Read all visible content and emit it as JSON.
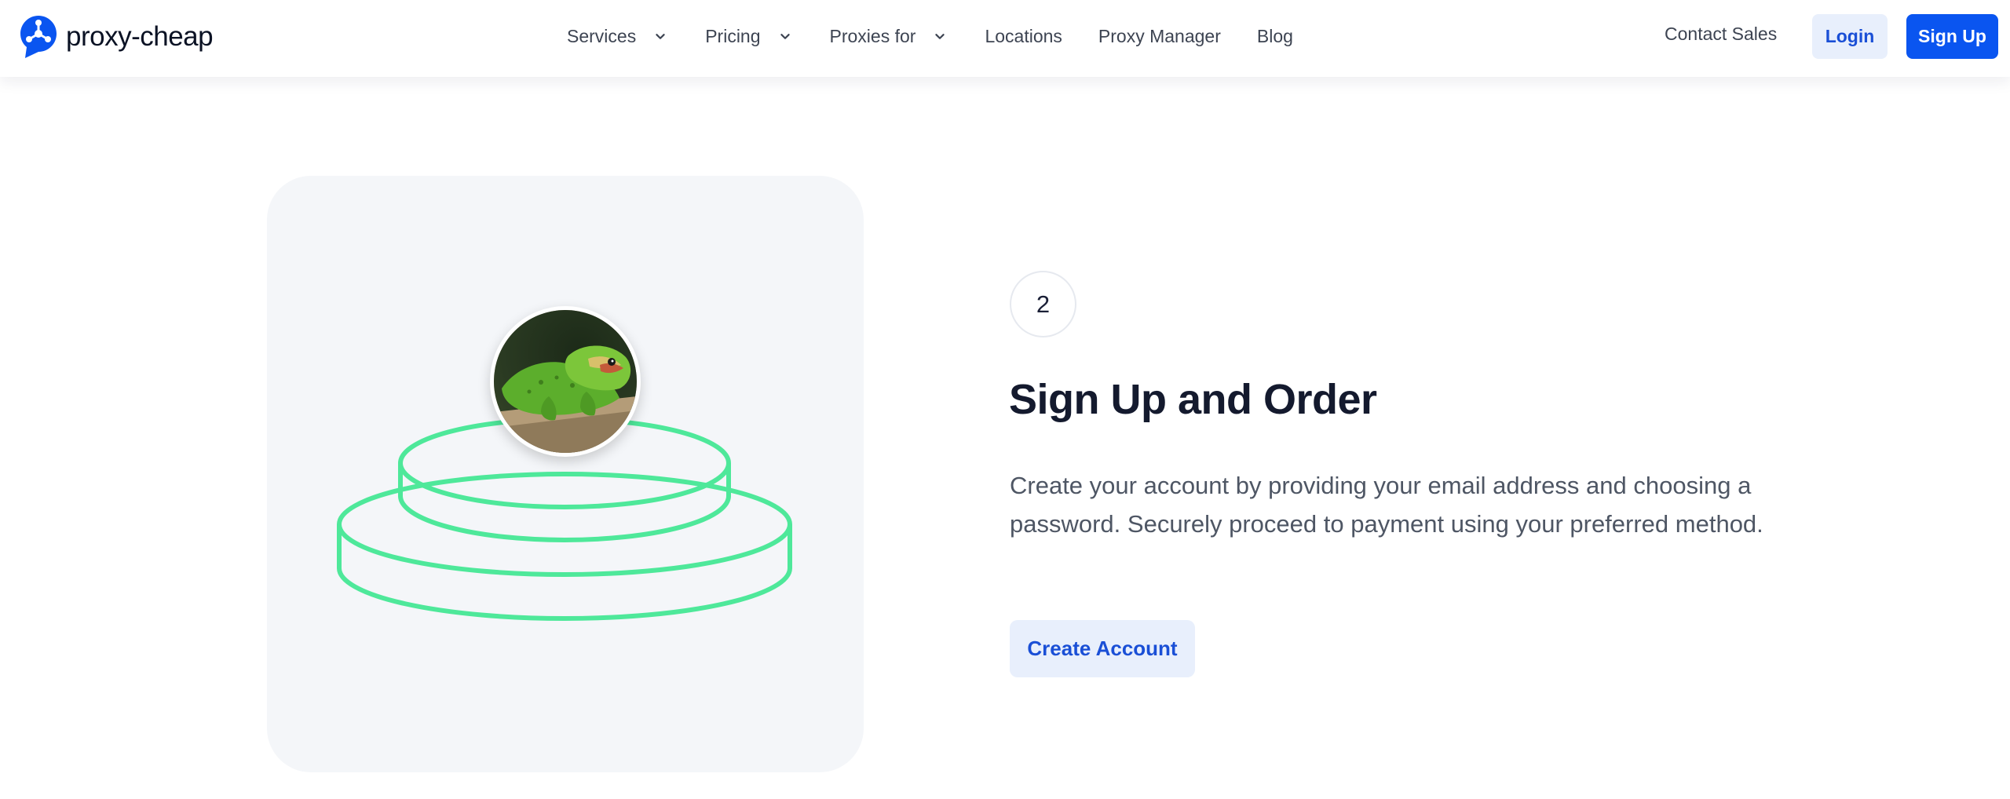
{
  "brand": {
    "name_light": "proxy-",
    "name_bold": "cheap",
    "color": "#0a55f0"
  },
  "nav": {
    "items": [
      {
        "label": "Services",
        "has_dropdown": true
      },
      {
        "label": "Pricing",
        "has_dropdown": true
      },
      {
        "label": "Proxies for",
        "has_dropdown": true
      },
      {
        "label": "Locations",
        "has_dropdown": false
      },
      {
        "label": "Proxy Manager",
        "has_dropdown": false
      },
      {
        "label": "Blog",
        "has_dropdown": false
      }
    ]
  },
  "header_actions": {
    "contact_sales": "Contact Sales",
    "login": "Login",
    "signup": "Sign Up"
  },
  "step": {
    "number": "2",
    "title": "Sign Up and Order",
    "description": "Create your account by providing your email address and choosing a password. Securely proceed to payment using your preferred method.",
    "cta": "Create Account"
  },
  "illustration": {
    "ring_color": "#4ee89a",
    "icons": [
      "chameleon-avatar",
      "stacked-platform"
    ]
  }
}
